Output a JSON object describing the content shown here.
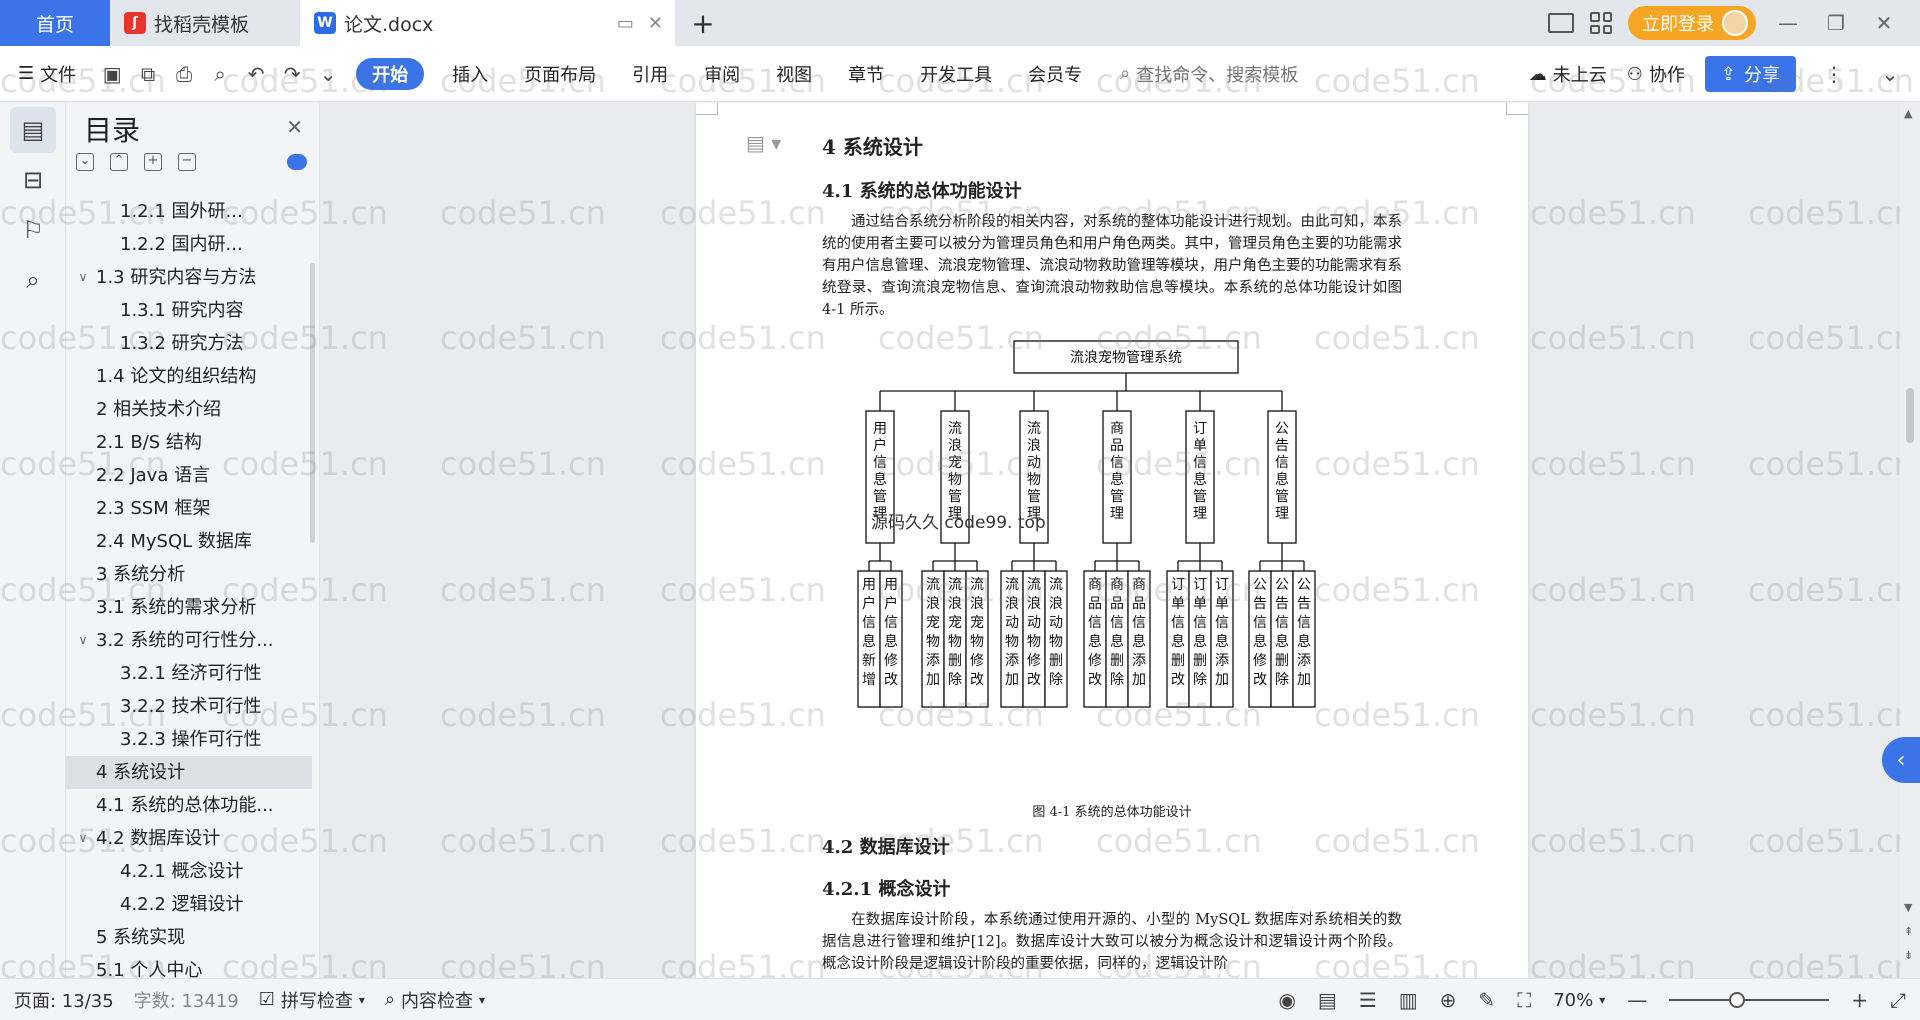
{
  "tabs": {
    "home": "首页",
    "template": "找稻壳模板",
    "doc": "论文.docx",
    "login": "立即登录"
  },
  "toolbar": {
    "file": "文件",
    "start": "开始",
    "insert": "插入",
    "layout": "页面布局",
    "reference": "引用",
    "review": "审阅",
    "view": "视图",
    "chapter": "章节",
    "dev": "开发工具",
    "member": "会员专",
    "search_placeholder": "查找命令、搜索模板",
    "cloud": "未上云",
    "collab": "协作",
    "share": "分享"
  },
  "outline": {
    "title": "目录",
    "items": [
      {
        "label": "1.2.1 国外研...",
        "level": 3,
        "caret": ""
      },
      {
        "label": "1.2.2 国内研...",
        "level": 3,
        "caret": ""
      },
      {
        "label": "1.3 研究内容与方法",
        "level": 2,
        "caret": "v"
      },
      {
        "label": "1.3.1 研究内容",
        "level": 3,
        "caret": ""
      },
      {
        "label": "1.3.2 研究方法",
        "level": 3,
        "caret": ""
      },
      {
        "label": "1.4 论文的组织结构",
        "level": 2,
        "caret": ""
      },
      {
        "label": "2 相关技术介绍",
        "level": 2,
        "caret": ""
      },
      {
        "label": "2.1 B/S 结构",
        "level": 2,
        "caret": ""
      },
      {
        "label": "2.2 Java 语言",
        "level": 2,
        "caret": ""
      },
      {
        "label": "2.3 SSM 框架",
        "level": 2,
        "caret": ""
      },
      {
        "label": "2.4 MySQL 数据库",
        "level": 2,
        "caret": ""
      },
      {
        "label": "3 系统分析",
        "level": 2,
        "caret": ""
      },
      {
        "label": "3.1 系统的需求分析",
        "level": 2,
        "caret": ""
      },
      {
        "label": "3.2 系统的可行性分...",
        "level": 2,
        "caret": "v"
      },
      {
        "label": "3.2.1 经济可行性",
        "level": 3,
        "caret": ""
      },
      {
        "label": "3.2.2 技术可行性",
        "level": 3,
        "caret": ""
      },
      {
        "label": "3.2.3 操作可行性",
        "level": 3,
        "caret": ""
      },
      {
        "label": "4 系统设计",
        "level": 2,
        "caret": "",
        "selected": true
      },
      {
        "label": "4.1 系统的总体功能...",
        "level": 2,
        "caret": ""
      },
      {
        "label": "4.2 数据库设计",
        "level": 2,
        "caret": "v"
      },
      {
        "label": "4.2.1 概念设计",
        "level": 3,
        "caret": ""
      },
      {
        "label": "4.2.2 逻辑设计",
        "level": 3,
        "caret": ""
      },
      {
        "label": "5 系统实现",
        "level": 2,
        "caret": ""
      },
      {
        "label": "5.1 个人中心",
        "level": 2,
        "caret": ""
      }
    ]
  },
  "doc": {
    "h1": "4 系统设计",
    "h2_1": "4.1 系统的总体功能设计",
    "para1": "通过结合系统分析阶段的相关内容，对系统的整体功能设计进行规划。由此可知，本系统的使用者主要可以被分为管理员角色和用户角色两类。其中，管理员角色主要的功能需求有用户信息管理、流浪宠物管理、流浪动物救助管理等模块，用户角色主要的功能需求有系统登录、查询流浪宠物信息、查询流浪动物救助信息等模块。本系统的总体功能设计如图 4-1 所示。",
    "caption": "图 4-1 系统的总体功能设计",
    "h2_2": "4.2 数据库设计",
    "h3_1": "4.2.1 概念设计",
    "para2": "在数据库设计阶段，本系统通过使用开源的、小型的 MySQL 数据库对系统相关的数据信息进行管理和维护[12]。数据库设计大致可以被分为概念设计和逻辑设计两个阶段。概念设计阶段是逻辑设计阶段的重要依据，同样的，逻辑设计阶",
    "inline_watermark": "源码久久 code99. top"
  },
  "diagram": {
    "root": "流浪宠物管理系统",
    "modules": [
      {
        "name": "用户信息管理",
        "children": [
          "用户信息新增",
          "用户信息修改"
        ]
      },
      {
        "name": "流浪宠物管理",
        "children": [
          "流浪宠物添加",
          "流浪宠物删除",
          "流浪宠物修改"
        ]
      },
      {
        "name": "流浪动物管理",
        "children": [
          "流浪动物添加",
          "流浪动物修改",
          "流浪动物删除"
        ]
      },
      {
        "name": "商品信息管理",
        "children": [
          "商品信息修改",
          "商品信息删除",
          "商品信息添加"
        ]
      },
      {
        "name": "订单信息管理",
        "children": [
          "订单信息删改",
          "订单信息删除",
          "订单信息添加"
        ]
      },
      {
        "name": "公告信息管理",
        "children": [
          "公告信息修改",
          "公告信息删除",
          "公告信息添加"
        ]
      }
    ]
  },
  "watermark": "code51.cn",
  "status": {
    "page": "页面: 13/35",
    "words": "字数: 13419",
    "spell": "拼写检查",
    "content": "内容检查",
    "zoom": "70%"
  },
  "colors": {
    "accent": "#3a74e8",
    "login": "#f6a623"
  }
}
